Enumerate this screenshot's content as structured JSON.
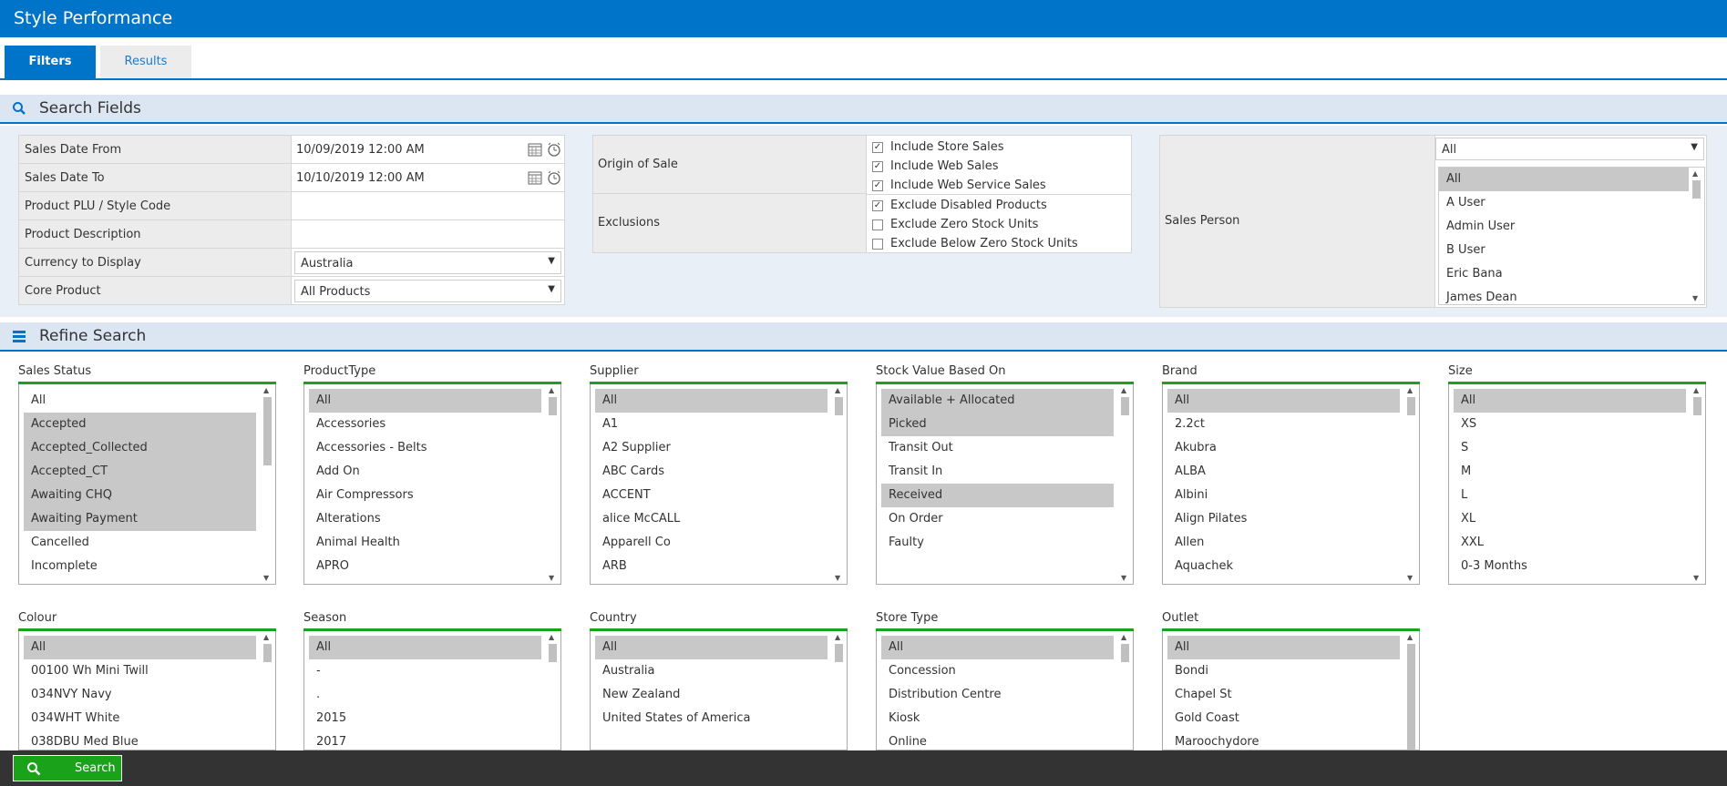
{
  "app": {
    "title": "Style Performance"
  },
  "tabs": [
    {
      "label": "Filters"
    },
    {
      "label": "Results"
    }
  ],
  "search_fields": {
    "title": "Search Fields",
    "rows": [
      {
        "label": "Sales Date From",
        "value": "10/09/2019 12:00 AM"
      },
      {
        "label": "Sales Date To",
        "value": "10/10/2019 12:00 AM"
      },
      {
        "label": "Product PLU / Style Code",
        "value": ""
      },
      {
        "label": "Product Description",
        "value": ""
      },
      {
        "label": "Currency to Display",
        "value": "Australia"
      },
      {
        "label": "Core Product",
        "value": "All Products"
      }
    ],
    "origin": {
      "label": "Origin of Sale",
      "options": [
        {
          "label": "Include Store Sales",
          "checked": true
        },
        {
          "label": "Include Web Sales",
          "checked": true
        },
        {
          "label": "Include Web Service Sales",
          "checked": true
        }
      ]
    },
    "exclusions": {
      "label": "Exclusions",
      "options": [
        {
          "label": "Exclude Disabled Products",
          "checked": true
        },
        {
          "label": "Exclude Zero Stock Units",
          "checked": false
        },
        {
          "label": "Exclude Below Zero Stock Units",
          "checked": false
        }
      ]
    },
    "sales_person": {
      "label": "Sales Person",
      "dropdown": "All",
      "items": [
        "All",
        "A User",
        "Admin User",
        "B User",
        "Eric Bana",
        "James Dean"
      ]
    }
  },
  "refine": {
    "title": "Refine Search",
    "groups": [
      {
        "label": "Sales Status",
        "items": [
          "All",
          "Accepted",
          "Accepted_Collected",
          "Accepted_CT",
          "Awaiting CHQ",
          "Awaiting Payment",
          "Cancelled",
          "Incomplete"
        ],
        "selected": [
          1,
          2,
          3,
          4,
          5
        ]
      },
      {
        "label": "ProductType",
        "items": [
          "All",
          "Accessories",
          "Accessories - Belts",
          "Add On",
          "Air Compressors",
          "Alterations",
          "Animal Health",
          "APRO"
        ],
        "selected": [
          0
        ]
      },
      {
        "label": "Supplier",
        "items": [
          "All",
          "A1",
          "A2 Supplier",
          "ABC Cards",
          "ACCENT",
          "alice McCALL",
          "Apparell Co",
          "ARB"
        ],
        "selected": [
          0
        ]
      },
      {
        "label": "Stock Value Based On",
        "items": [
          "Available + Allocated",
          "Picked",
          "Transit Out",
          "Transit In",
          "Received",
          "On Order",
          "Faulty"
        ],
        "selected": [
          0,
          1,
          4
        ]
      },
      {
        "label": "Brand",
        "items": [
          "All",
          "2.2ct",
          "Akubra",
          "ALBA",
          "Albini",
          "Align Pilates",
          "Allen",
          "Aquachek"
        ],
        "selected": [
          0
        ]
      },
      {
        "label": "Size",
        "items": [
          "All",
          "XS",
          "S",
          "M",
          "L",
          "XL",
          "XXL",
          "0-3 Months"
        ],
        "selected": [
          0
        ]
      },
      {
        "label": "Colour",
        "items": [
          "All",
          "00100 Wh Mini Twill",
          "034NVY Navy",
          "034WHT White",
          "038DBU Med Blue"
        ],
        "selected": [
          0
        ]
      },
      {
        "label": "Season",
        "items": [
          "All",
          "-",
          ".",
          "2015",
          "2017"
        ],
        "selected": [
          0
        ]
      },
      {
        "label": "Country",
        "items": [
          "All",
          "Australia",
          "New Zealand",
          "United States of America"
        ],
        "selected": [
          0
        ]
      },
      {
        "label": "Store Type",
        "items": [
          "All",
          "Concession",
          "Distribution Centre",
          "Kiosk",
          "Online"
        ],
        "selected": [
          0
        ]
      },
      {
        "label": "Outlet",
        "items": [
          "All",
          "Bondi",
          "Chapel St",
          "Gold Coast",
          "Maroochydore"
        ],
        "selected": [
          0
        ]
      }
    ]
  },
  "footer": {
    "search_label": "Search"
  }
}
